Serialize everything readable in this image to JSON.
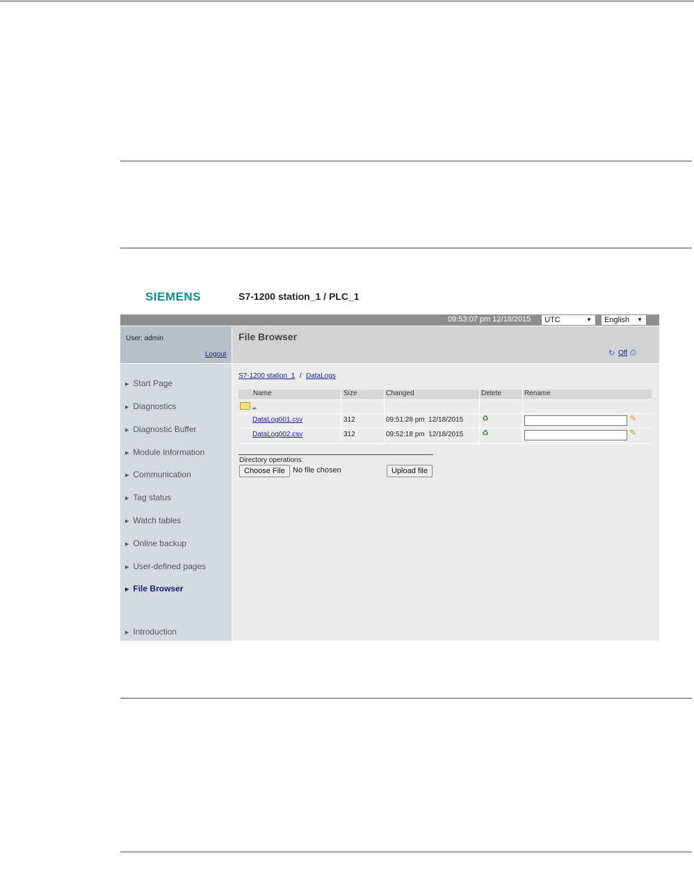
{
  "brand": "SIEMENS",
  "station_title": "S7-1200 station_1 / PLC_1",
  "topbar": {
    "clock": "09:53:07 pm  12/18/2015",
    "timezone": "UTC",
    "language": "English"
  },
  "user": {
    "label": "User: admin",
    "logout": "Logout"
  },
  "page_title": "File Browser",
  "toolbar": {
    "refresh_icon": "refresh-icon",
    "refresh_state": "Off",
    "print_icon": "print-icon"
  },
  "sidebar": {
    "items": [
      {
        "label": "Start Page"
      },
      {
        "label": "Diagnostics"
      },
      {
        "label": "Diagnostic Buffer"
      },
      {
        "label": "Module Information"
      },
      {
        "label": "Communication"
      },
      {
        "label": "Tag status"
      },
      {
        "label": "Watch tables"
      },
      {
        "label": "Online backup"
      },
      {
        "label": "User-defined pages"
      },
      {
        "label": "File Browser",
        "active": true
      },
      {
        "label": "Introduction"
      }
    ]
  },
  "breadcrumb": {
    "root": "S7-1200 station_1",
    "separator": " / ",
    "folder": "DataLogs"
  },
  "table": {
    "columns": [
      "Name",
      "Size",
      "Changed",
      "Delete",
      "Rename"
    ],
    "parent_dir": "..",
    "rows": [
      {
        "name": "DataLog001.csv",
        "size": "312",
        "changed": "09:51:28 pm  12/18/2015",
        "rename_value": ""
      },
      {
        "name": "DataLog002.csv",
        "size": "312",
        "changed": "09:52:18 pm  12/18/2015",
        "rename_value": ""
      }
    ]
  },
  "directory_ops": {
    "label": "Directory operations:",
    "choose_file": "Choose File",
    "no_file": "No file chosen",
    "upload": "Upload file"
  }
}
